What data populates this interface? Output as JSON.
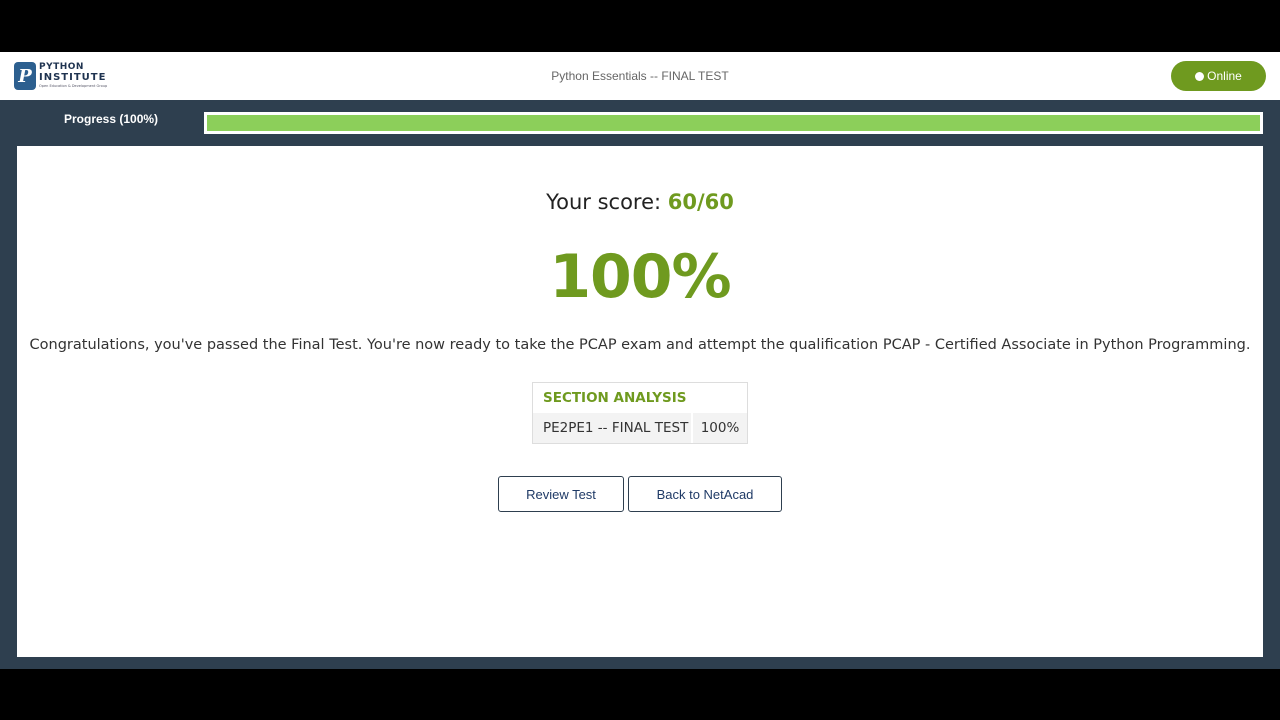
{
  "logo": {
    "mark": "P",
    "line1": "PYTHON",
    "line2": "INSTITUTE",
    "tagline": "Open Education & Development Group"
  },
  "header": {
    "title": "Python Essentials -- FINAL TEST",
    "status_label": "Online"
  },
  "progress": {
    "label": "Progress (100%)",
    "value_percent": 100
  },
  "result": {
    "score_prefix": "Your score:",
    "score_value": "60/60",
    "percent": "100%",
    "message": "Congratulations, you've passed the Final Test. You're now ready to take the PCAP exam and attempt the qualification PCAP - Certified Associate in Python Programming."
  },
  "section_analysis": {
    "heading": "SECTION ANALYSIS",
    "rows": [
      {
        "name": "PE2PE1 -- FINAL TEST",
        "value": "100%"
      }
    ]
  },
  "actions": {
    "review_label": "Review Test",
    "back_label": "Back to NetAcad"
  },
  "colors": {
    "accent_green": "#6f9a1f",
    "progress_green": "#8ccf5a",
    "frame_slate": "#2e3f4f"
  }
}
